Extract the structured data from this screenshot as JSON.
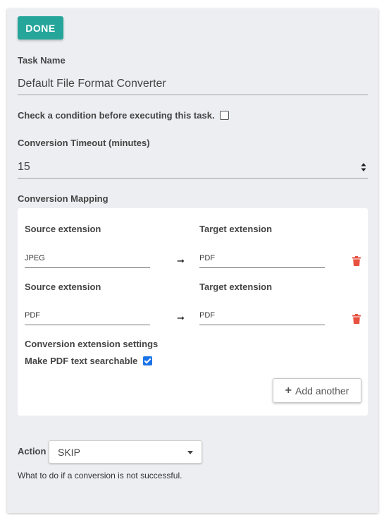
{
  "header": {
    "done_label": "DONE"
  },
  "task": {
    "name_label": "Task Name",
    "name_value": "Default File Format Converter",
    "condition_label": "Check a condition before executing this task.",
    "condition_checked": false
  },
  "timeout": {
    "label": "Conversion Timeout (minutes)",
    "value": "15"
  },
  "mapping": {
    "label": "Conversion Mapping",
    "rows": [
      {
        "source_label": "Source extension",
        "source_value": "JPEG",
        "arrow": "➞",
        "target_label": "Target extension",
        "target_value": "PDF"
      },
      {
        "source_label": "Source extension",
        "source_value": "PDF",
        "arrow": "➞",
        "target_label": "Target extension",
        "target_value": "PDF"
      }
    ],
    "settings_label": "Conversion extension settings",
    "searchable_label": "Make PDF text searchable",
    "searchable_checked": true,
    "add_label": "Add another",
    "add_icon": "plus-icon"
  },
  "action": {
    "label": "Action",
    "selected": "SKIP",
    "help": "What to do if a conversion is not successful."
  },
  "colors": {
    "accent": "#26a69a",
    "delete": "#e8513f",
    "checkbox": "#1a73e8"
  }
}
